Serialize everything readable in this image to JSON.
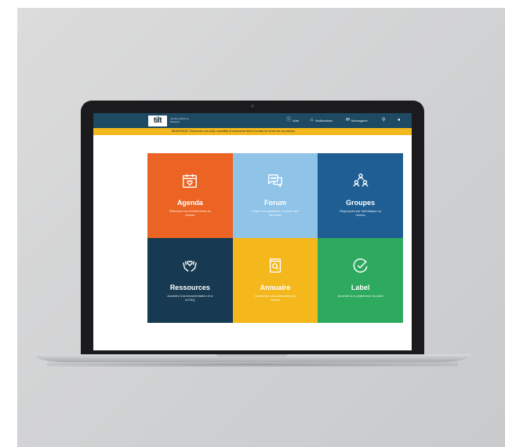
{
  "header": {
    "logo_text": "tilt",
    "logo_sub": "Jeunes publics en Bretagne",
    "nav": [
      {
        "label": "Aide",
        "icon": "help-icon"
      },
      {
        "label": "Notifications",
        "icon": "bell-icon"
      },
      {
        "label": "Messagerie",
        "icon": "envelope-icon"
      },
      {
        "label": "",
        "icon": "search-icon"
      },
      {
        "label": "",
        "icon": "user-icon"
      }
    ]
  },
  "banner": {
    "text": "BIENVENUE ! Découvrez vos outils, actualités et ressources liées à la mise en œuvre de vos actions."
  },
  "tiles": [
    {
      "title": "Agenda",
      "desc": "Retrouvez les événements du réseau",
      "color": "#ec6424",
      "icon": "calendar-heart-icon"
    },
    {
      "title": "Forum",
      "desc": "Posez vos questions, trouvez des réponses",
      "color": "#8fc3e8",
      "icon": "chat-bubbles-icon"
    },
    {
      "title": "Groupes",
      "desc": "Regroupés par thématique ou réseau",
      "color": "#1e5e93",
      "icon": "users-group-icon"
    },
    {
      "title": "Ressources",
      "desc": "Accédez à la documentation et à la FAQ",
      "color": "#173a52",
      "icon": "hands-heart-icon"
    },
    {
      "title": "Annuaire",
      "desc": "Contactez vos partenaires du réseau",
      "color": "#f4b81d",
      "icon": "book-search-icon"
    },
    {
      "title": "Label",
      "desc": "Accédez à la plateforme du label",
      "color": "#2eaa5f",
      "icon": "badge-check-icon"
    }
  ]
}
